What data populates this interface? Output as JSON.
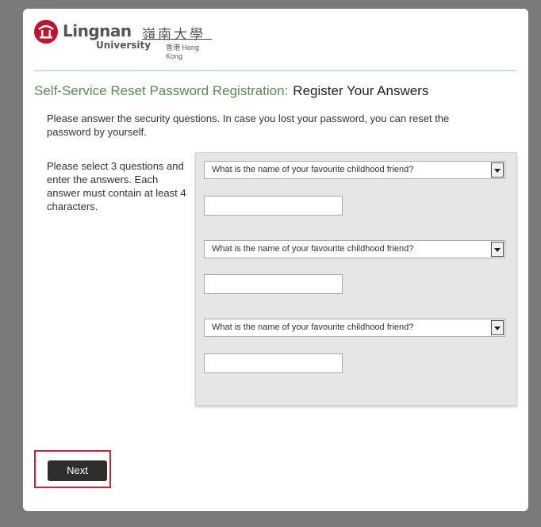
{
  "logo": {
    "name": "Lingnan",
    "chinese": "嶺南大學",
    "university": "University",
    "location": "香港 Hong Kong"
  },
  "page": {
    "title_prefix": "Self-Service Reset Password Registration:",
    "title_suffix": "Register Your Answers",
    "intro": "Please answer the security questions. In case you lost your password, you can reset the password by yourself.",
    "instructions": "Please select 3 questions and enter the answers. Each answer must contain at least 4 characters."
  },
  "questions": [
    {
      "selected": "What is the name of your favourite childhood friend?",
      "answer": ""
    },
    {
      "selected": "What is the name of your favourite childhood friend?",
      "answer": ""
    },
    {
      "selected": "What is the name of your favourite childhood friend?",
      "answer": ""
    }
  ],
  "buttons": {
    "next_label": "Next"
  },
  "colors": {
    "accent_green": "#5b8c4e",
    "highlight_red": "#d9202a",
    "brand_red": "#c8102e"
  }
}
